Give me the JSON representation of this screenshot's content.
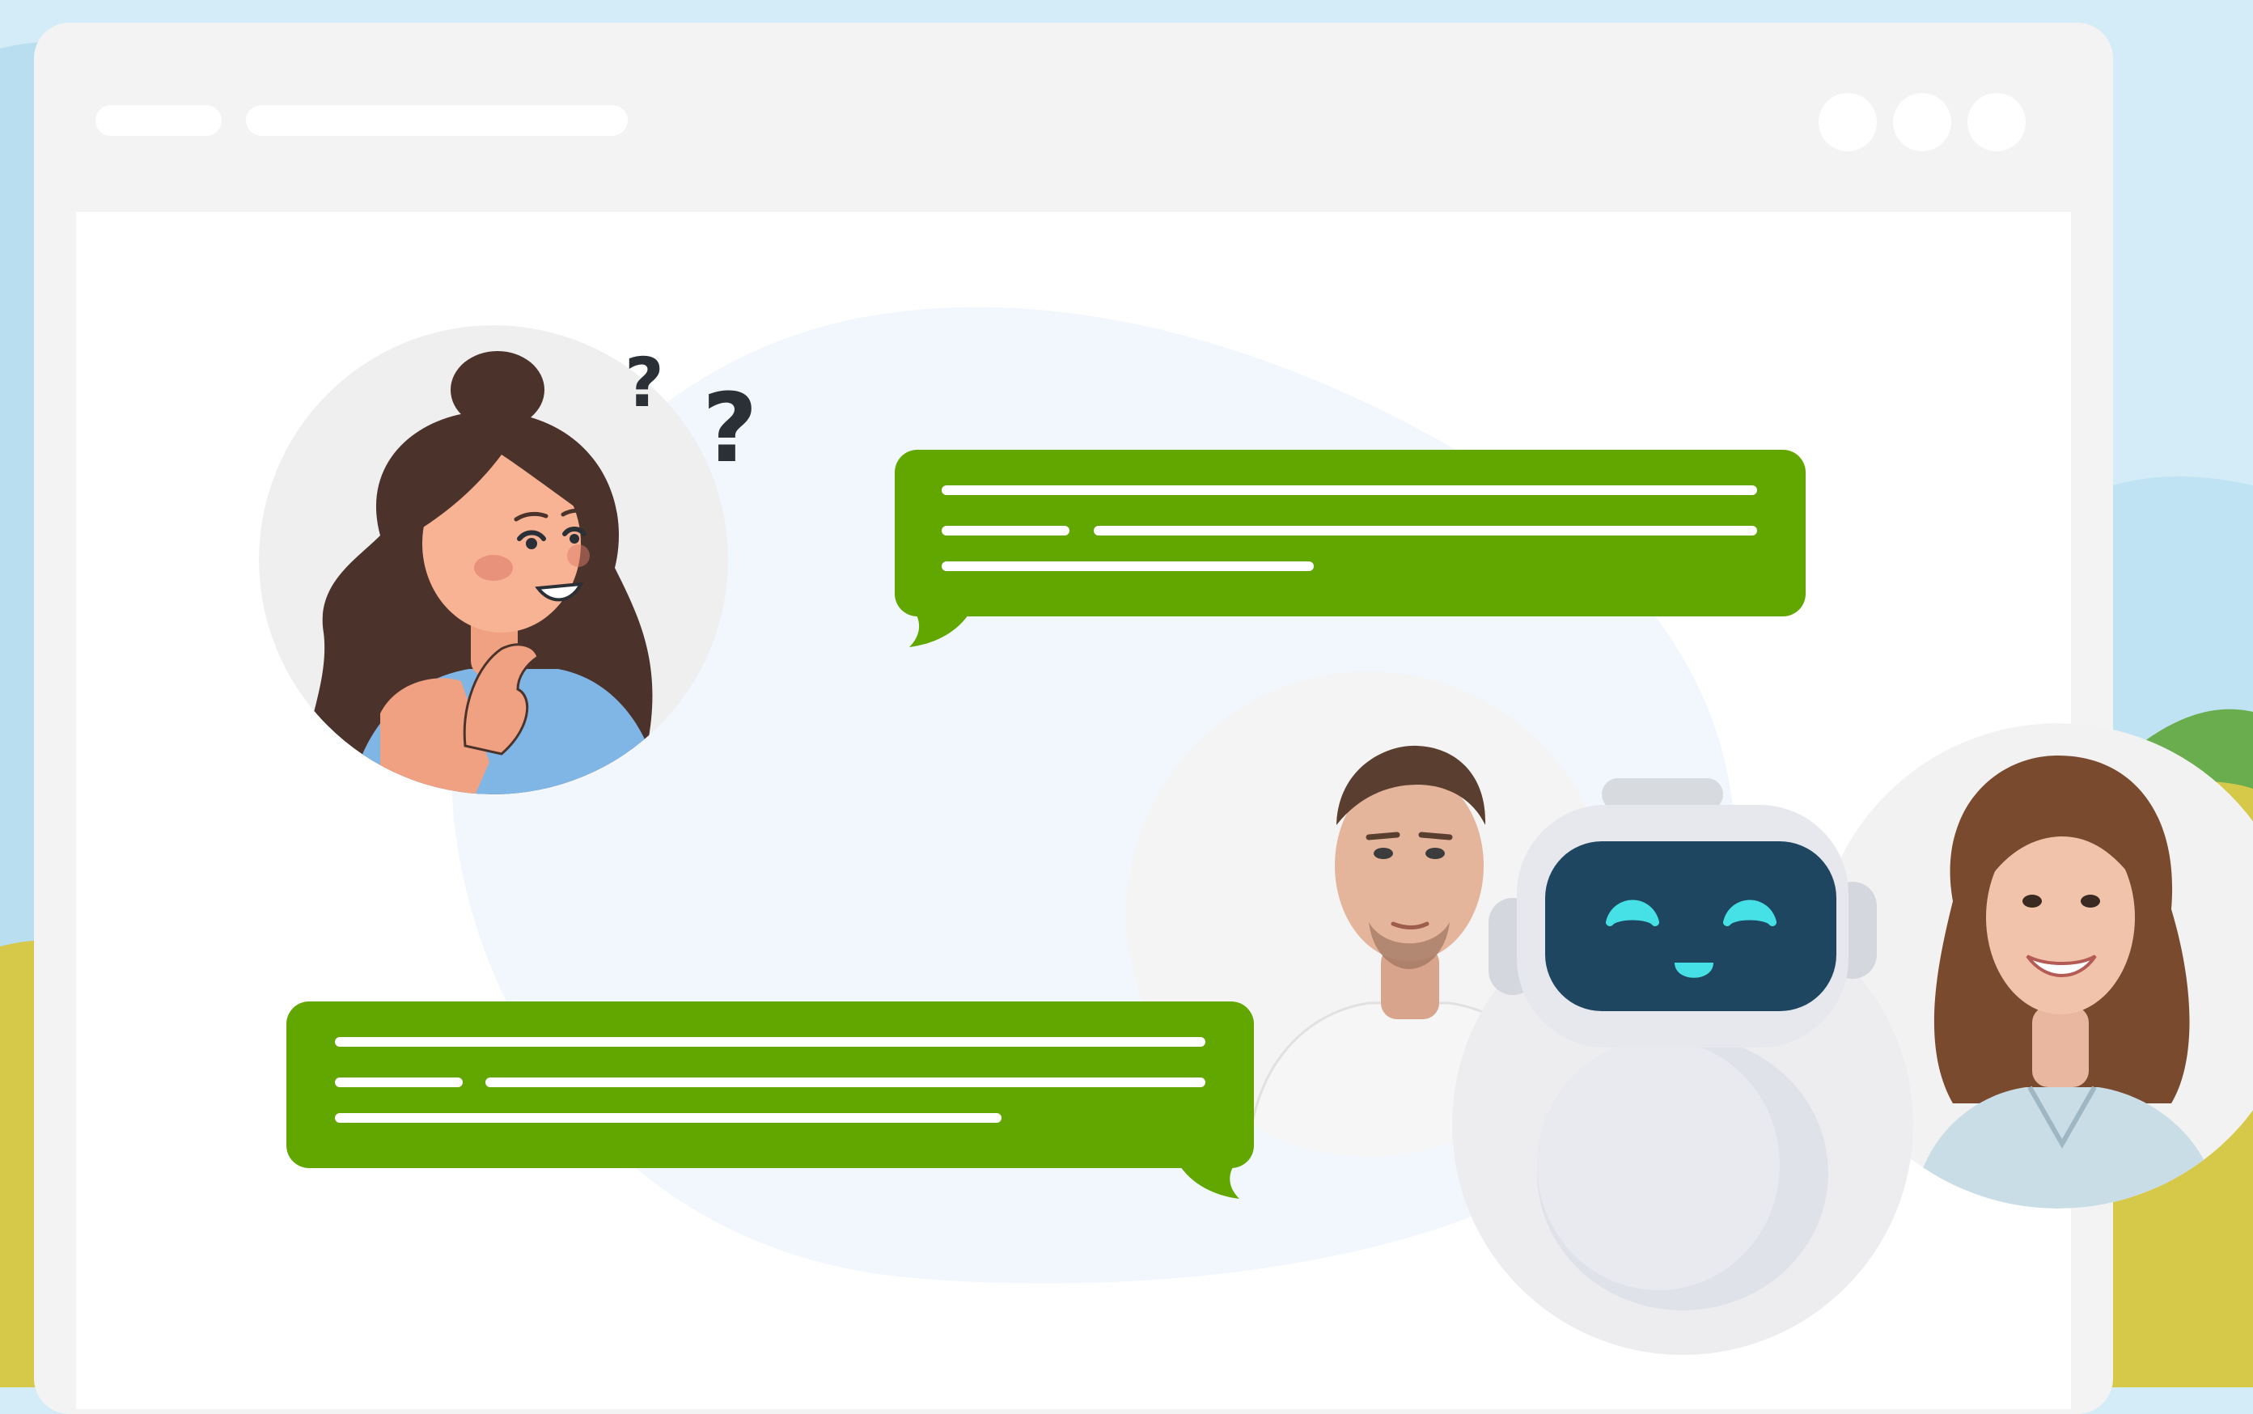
{
  "colors": {
    "sky": "#d3ecf8",
    "window": "#f3f3f3",
    "content": "#ffffff",
    "blob": "#f1f7fd",
    "bubble": "#62a700",
    "bubble_line": "#ffffff",
    "robot_screen": "#1f4660",
    "robot_eye": "#46e1e6"
  },
  "window": {
    "titlebar_placeholders": 2,
    "control_dots": 3
  },
  "chat": {
    "messages": [
      {
        "sender": "user-illustration",
        "lines": 3,
        "tail": "bottom-left"
      },
      {
        "sender": "support-team",
        "lines": 3,
        "tail": "bottom-right"
      }
    ]
  },
  "decorations": {
    "question_marks": [
      "?",
      "?"
    ]
  },
  "icons": [
    "thinking-woman-illustration",
    "question-mark-icon",
    "man-photo",
    "chatbot-robot-icon",
    "woman-photo"
  ]
}
